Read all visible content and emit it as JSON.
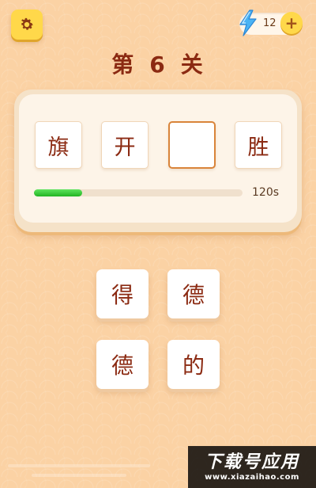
{
  "header": {
    "settings_icon": "gear-icon",
    "energy_icon": "lightning-bolt-icon",
    "energy_count": "12",
    "add_label": "+"
  },
  "level": {
    "prefix": "第",
    "number": "6",
    "suffix": "关"
  },
  "puzzle": {
    "slots": [
      "旗",
      "开",
      "",
      "胜"
    ],
    "progress": 0.23,
    "timer": "120s"
  },
  "choices": [
    "得",
    "德",
    "德",
    "的"
  ],
  "watermark": {
    "title": "下载号应用",
    "url": "www.xiazaihao.com"
  },
  "colors": {
    "background": "#fbd2a4",
    "accent_yellow": "#ffd84a",
    "title_red": "#8b2a12",
    "progress_green": "#2fc42f",
    "empty_slot_border": "#d9843a"
  }
}
